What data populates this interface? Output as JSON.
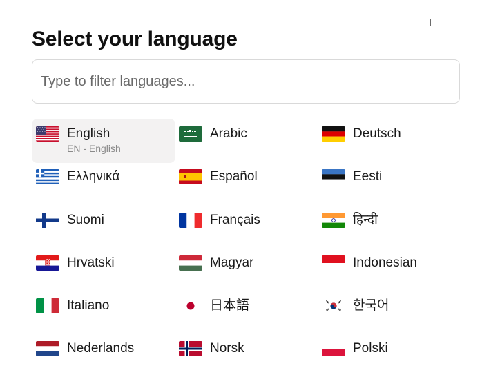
{
  "title": "Select your language",
  "search": {
    "placeholder": "Type to filter languages..."
  },
  "selected_code": "EN - English",
  "languages": [
    {
      "name": "English",
      "flag": "us-flag-icon"
    },
    {
      "name": "Arabic",
      "flag": "saudi-arabia-flag-icon"
    },
    {
      "name": "Deutsch",
      "flag": "germany-flag-icon"
    },
    {
      "name": "Ελληνικά",
      "flag": "greece-flag-icon"
    },
    {
      "name": "Español",
      "flag": "spain-flag-icon"
    },
    {
      "name": "Eesti",
      "flag": "estonia-flag-icon"
    },
    {
      "name": "Suomi",
      "flag": "finland-flag-icon"
    },
    {
      "name": "Français",
      "flag": "france-flag-icon"
    },
    {
      "name": "हिन्दी",
      "flag": "india-flag-icon"
    },
    {
      "name": "Hrvatski",
      "flag": "croatia-flag-icon"
    },
    {
      "name": "Magyar",
      "flag": "hungary-flag-icon"
    },
    {
      "name": "Indonesian",
      "flag": "indonesia-flag-icon"
    },
    {
      "name": "Italiano",
      "flag": "italy-flag-icon"
    },
    {
      "name": "日本語",
      "flag": "japan-flag-icon"
    },
    {
      "name": "한국어",
      "flag": "korea-flag-icon"
    },
    {
      "name": "Nederlands",
      "flag": "netherlands-flag-icon"
    },
    {
      "name": "Norsk",
      "flag": "norway-flag-icon"
    },
    {
      "name": "Polski",
      "flag": "poland-flag-icon"
    }
  ]
}
